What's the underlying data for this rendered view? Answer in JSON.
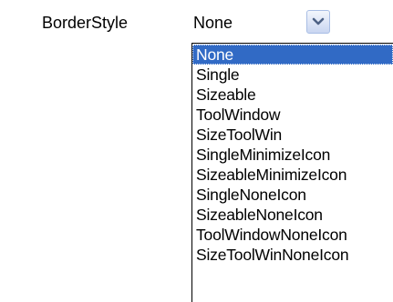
{
  "property": {
    "label": "BorderStyle",
    "value": "None"
  },
  "dropdown": {
    "selected_index": 0,
    "items": [
      "None",
      "Single",
      "Sizeable",
      "ToolWindow",
      "SizeToolWin",
      "SingleMinimizeIcon",
      "SizeableMinimizeIcon",
      "SingleNoneIcon",
      "SizeableNoneIcon",
      "ToolWindowNoneIcon",
      "SizeToolWinNoneIcon"
    ]
  },
  "colors": {
    "selection": "#316ac5",
    "combo_button": "#c9d6f1",
    "arrow": "#4d6185"
  },
  "icons": {
    "combo_arrow": "chevron-down-icon"
  }
}
